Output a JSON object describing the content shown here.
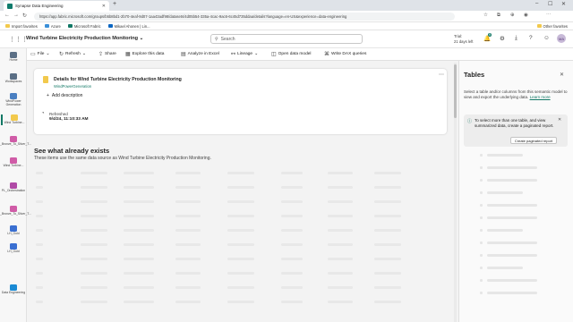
{
  "browser": {
    "tab_title": "Synapse Data Engineering",
    "new_tab": "+",
    "url": "https://app.fabric.microsoft.com/groups/b5b8bd1-2b70-4eaf-9d07-1aa43adf98/datasets/4d05b54-335a-4cac-9ac6-6c45d735ddaa/details?language=en-US&experience=data-engineering",
    "favorites": [
      "Import favorites",
      "Azure",
      "Microsoft Fabric",
      "Mikael Ahonen | Lin..."
    ],
    "other_favorites": "Other favorites"
  },
  "header": {
    "title": "Wind Turbine Electricity Production Monitoring",
    "title_chevron": "⌄",
    "search_placeholder": "Search",
    "trial_line1": "Trial:",
    "trial_line2": "21 days left",
    "notifications_count": "9",
    "avatar_initials": "MA"
  },
  "rail": [
    {
      "label": "Home",
      "color": "#5b6f85"
    },
    {
      "label": "Workspaces",
      "color": "#5b6f85"
    },
    {
      "label": "WindPower Generation",
      "color": "#4a7fc1"
    },
    {
      "label": "Wind Turbine...",
      "color": "#f2c94c",
      "active": true
    },
    {
      "label": "NB_Bronze_To_Silver_T...",
      "color": "#d05ca7"
    },
    {
      "label": "Wind Turbine...",
      "color": "#d05ca7"
    },
    {
      "label": "PL_Orchestration",
      "color": "#b04aa6"
    },
    {
      "label": "NB_Bronze_To_Silver_T...",
      "color": "#d05ca7"
    },
    {
      "label": "LH_Gold",
      "color": "#3a6fd1"
    },
    {
      "label": "LH_Gold",
      "color": "#3a6fd1"
    },
    {
      "label": "Data Engineering",
      "color": "#1a8ad4"
    }
  ],
  "toolbar": {
    "file": "File",
    "refresh": "Refresh",
    "share": "Share",
    "explore": "Explore this data",
    "analyze": "Analyze in Excel",
    "lineage": "Lineage",
    "open_model": "Open data model",
    "dax": "Write DAX queries"
  },
  "details": {
    "title": "Details for Wind Turbine Electricity Production Monitoring",
    "workspace": "WindPowerGeneration",
    "add_description": "Add description",
    "refreshed_label": "Refreshed",
    "refreshed_time": "9/4/24, 11:10:33 AM"
  },
  "related": {
    "heading": "See what already exists",
    "subheading": "These items use the same data source as Wind Turbine Electricity Production Monitoring."
  },
  "tables_panel": {
    "title": "Tables",
    "description": "Select a table and/or columns from this semantic model to view and export the underlying data.",
    "learn_more": "Learn more",
    "info_text": "To select more than one table, and view summarized data, create a paginated report.",
    "create_button": "Create paginated report"
  }
}
